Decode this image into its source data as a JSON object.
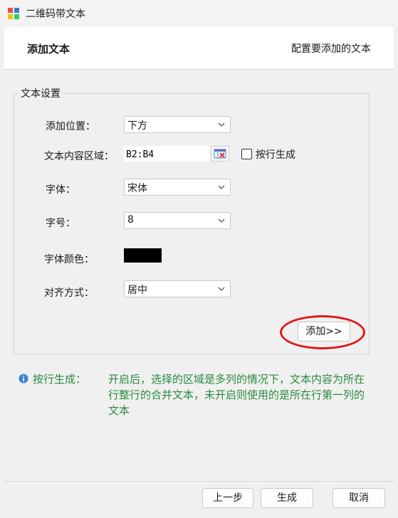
{
  "window": {
    "title": "二维码带文本"
  },
  "header": {
    "title": "添加文本",
    "description": "配置要添加的文本"
  },
  "group": {
    "legend": "文本设置",
    "position": {
      "label": "添加位置：",
      "value": "下方"
    },
    "range": {
      "label": "文本内容区域：",
      "value": "B2:B4"
    },
    "by_row": {
      "label": "按行生成",
      "checked": false
    },
    "font": {
      "label": "字体：",
      "value": "宋体"
    },
    "font_size": {
      "label": "字号：",
      "value": "8"
    },
    "font_color": {
      "label": "字体颜色：",
      "color": "#000000"
    },
    "align": {
      "label": "对齐方式：",
      "value": "居中"
    },
    "add_button": "添加>>"
  },
  "info": {
    "title": "按行生成：",
    "text": "开启后，选择的区域是多列的情况下，文本内容为所在行整行的合并文本，未开启则使用的是所在行第一列的文本"
  },
  "footer": {
    "prev": "上一步",
    "generate": "生成",
    "cancel": "取消"
  },
  "colors": {
    "accent_green": "#2a8a3e",
    "highlight_red": "#e01818"
  }
}
